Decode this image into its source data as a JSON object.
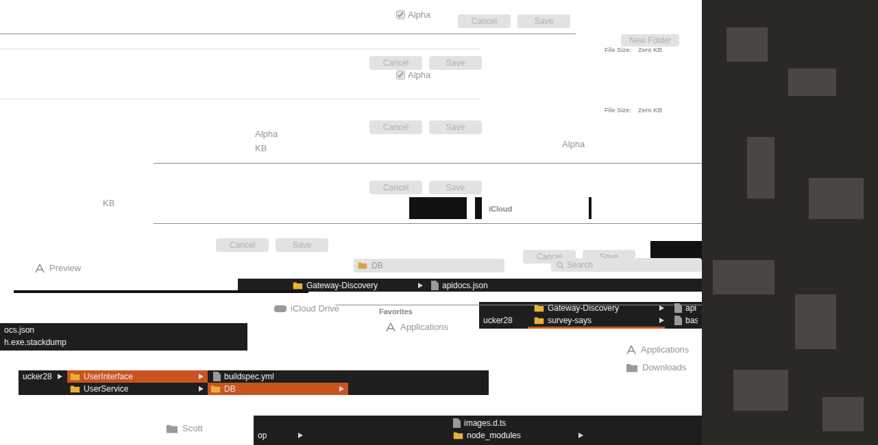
{
  "fragments": [
    {
      "kind": "checkbox",
      "label": "Alpha",
      "checked": true
    },
    {
      "kind": "checkbox",
      "label": "Alpha",
      "checked": true
    },
    {
      "kind": "buttons",
      "cancel": "Cancel",
      "save": "Save",
      "disabled": true
    },
    {
      "kind": "buttons",
      "cancel": "Cancel",
      "save": "Save",
      "disabled": true
    },
    {
      "kind": "buttons",
      "cancel": "Cancel",
      "save": "Save",
      "disabled": true
    },
    {
      "kind": "buttons",
      "cancel": "Cancel",
      "save": "Save",
      "disabled": true
    },
    {
      "kind": "buttons",
      "cancel": "Cancel",
      "save": "Save",
      "disabled": true
    },
    {
      "kind": "buttons",
      "cancel": "Cancel",
      "save": "Save",
      "disabled": true
    },
    {
      "kind": "button",
      "label": "New Folder",
      "disabled": true
    },
    {
      "kind": "file-size",
      "label": "File Size:",
      "value": "Zero KB"
    },
    {
      "kind": "file-size",
      "label": "File Size:",
      "value": "Zero KB"
    },
    {
      "kind": "text",
      "text": "Alpha"
    },
    {
      "kind": "text",
      "text": "Alpha"
    },
    {
      "kind": "text",
      "text": "KB"
    },
    {
      "kind": "text",
      "text": "KB"
    },
    {
      "kind": "heading",
      "text": "iCloud"
    },
    {
      "kind": "sidebar-app",
      "text": "Preview"
    },
    {
      "kind": "sidebar-drive",
      "text": "iCloud Drive"
    },
    {
      "kind": "heading",
      "text": "Favorites"
    },
    {
      "kind": "sidebar-app",
      "text": "Applications"
    },
    {
      "kind": "sidebar-app",
      "text": "Applications"
    },
    {
      "kind": "sidebar-folder",
      "text": "Downloads"
    },
    {
      "kind": "sidebar-folder",
      "text": "Scott"
    },
    {
      "kind": "popup",
      "text": "DB"
    },
    {
      "kind": "search",
      "placeholder": "Search"
    },
    {
      "kind": "folder",
      "text": "Gateway-Discovery",
      "selected": false,
      "expandable": true
    },
    {
      "kind": "file",
      "text": "apidocs.json",
      "selected": false,
      "expandable": false
    },
    {
      "kind": "plain",
      "text": "ucker28",
      "selected": false,
      "expandable": false
    },
    {
      "kind": "folder",
      "text": "Gateway-Discovery",
      "selected": false,
      "expandable": true
    },
    {
      "kind": "folder",
      "text": "survey-says",
      "selected": false,
      "expandable": true
    },
    {
      "kind": "file",
      "text": "api",
      "selected": false,
      "expandable": false
    },
    {
      "kind": "file",
      "text": "bas",
      "selected": false,
      "expandable": false
    },
    {
      "kind": "plain",
      "text": "ocs.json",
      "selected": false,
      "expandable": false
    },
    {
      "kind": "plain",
      "text": "h.exe.stackdump",
      "selected": false,
      "expandable": false
    },
    {
      "kind": "plain",
      "text": "ucker28",
      "selected": false,
      "expandable": true
    },
    {
      "kind": "folder",
      "text": "UserInterface",
      "selected": true,
      "expandable": true
    },
    {
      "kind": "folder",
      "text": "UserService",
      "selected": false,
      "expandable": true
    },
    {
      "kind": "file",
      "text": "buildspec.yml",
      "selected": false,
      "expandable": false
    },
    {
      "kind": "folder",
      "text": "DB",
      "selected": true,
      "expandable": true
    },
    {
      "kind": "plain",
      "text": "op",
      "selected": false,
      "expandable": true
    },
    {
      "kind": "file",
      "text": "images.d.ts",
      "selected": false,
      "expandable": false
    },
    {
      "kind": "folder",
      "text": "node_modules",
      "selected": false,
      "expandable": true
    }
  ]
}
